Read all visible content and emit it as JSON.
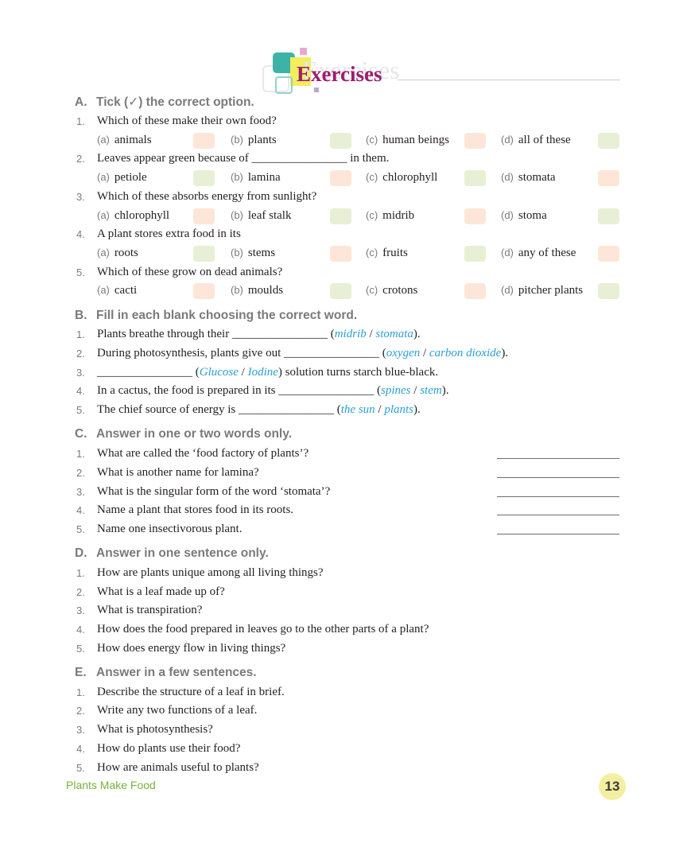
{
  "header": {
    "title": "Exercises"
  },
  "sections": {
    "A": {
      "letter": "A.",
      "heading": "Tick (✓) the correct option."
    },
    "B": {
      "letter": "B.",
      "heading": "Fill in each blank choosing the correct word."
    },
    "C": {
      "letter": "C.",
      "heading": "Answer in one or two words only."
    },
    "D": {
      "letter": "D.",
      "heading": "Answer in one sentence only."
    },
    "E": {
      "letter": "E.",
      "heading": "Answer in a few sentences."
    }
  },
  "mcq": [
    {
      "num": "1.",
      "q": "Which of these make their own food?",
      "opts": [
        {
          "l": "(a)",
          "t": "animals"
        },
        {
          "l": "(b)",
          "t": "plants"
        },
        {
          "l": "(c)",
          "t": "human beings"
        },
        {
          "l": "(d)",
          "t": "all of these"
        }
      ]
    },
    {
      "num": "2.",
      "q_pre": "Leaves appear green because of",
      "q_blank": "________________",
      "q_post": "in them.",
      "opts": [
        {
          "l": "(a)",
          "t": "petiole"
        },
        {
          "l": "(b)",
          "t": "lamina"
        },
        {
          "l": "(c)",
          "t": "chlorophyll"
        },
        {
          "l": "(d)",
          "t": "stomata"
        }
      ]
    },
    {
      "num": "3.",
      "q": "Which of these absorbs energy from sunlight?",
      "opts": [
        {
          "l": "(a)",
          "t": "chlorophyll"
        },
        {
          "l": "(b)",
          "t": "leaf stalk"
        },
        {
          "l": "(c)",
          "t": "midrib"
        },
        {
          "l": "(d)",
          "t": "stoma"
        }
      ]
    },
    {
      "num": "4.",
      "q": "A plant stores extra food in its",
      "opts": [
        {
          "l": "(a)",
          "t": "roots"
        },
        {
          "l": "(b)",
          "t": "stems"
        },
        {
          "l": "(c)",
          "t": "fruits"
        },
        {
          "l": "(d)",
          "t": "any of these"
        }
      ]
    },
    {
      "num": "5.",
      "q": "Which of these grow on dead animals?",
      "opts": [
        {
          "l": "(a)",
          "t": "cacti"
        },
        {
          "l": "(b)",
          "t": "moulds"
        },
        {
          "l": "(c)",
          "t": "crotons"
        },
        {
          "l": "(d)",
          "t": "pitcher plants"
        }
      ]
    }
  ],
  "fill": [
    {
      "num": "1.",
      "pre": "Plants breathe through their",
      "blank": "________________",
      "w1": "midrib",
      "sep": "/",
      "w2": "stomata",
      "post": ""
    },
    {
      "num": "2.",
      "pre": "During photosynthesis, plants give out",
      "blank": "________________",
      "w1": "oxygen",
      "sep": "/",
      "w2": "carbon dioxide",
      "post": ""
    },
    {
      "num": "3.",
      "pre": "",
      "blank": "________________",
      "w1": "Glucose",
      "sep": "/",
      "w2": "Iodine",
      "post": "solution turns starch blue-black."
    },
    {
      "num": "4.",
      "pre": "In a cactus, the food is prepared in its",
      "blank": "________________",
      "w1": "spines",
      "sep": "/",
      "w2": "stem",
      "post": ""
    },
    {
      "num": "5.",
      "pre": "The chief source of energy is",
      "blank": "________________",
      "w1": "the sun",
      "sep": "/",
      "w2": "plants",
      "post": ""
    }
  ],
  "short": [
    {
      "num": "1.",
      "q": "What are called the ‘food factory of plants’?"
    },
    {
      "num": "2.",
      "q": "What is another name for lamina?"
    },
    {
      "num": "3.",
      "q": "What is the singular form of the word ‘stomata’?"
    },
    {
      "num": "4.",
      "q": "Name a plant that stores food in its roots."
    },
    {
      "num": "5.",
      "q": "Name one insectivorous plant."
    }
  ],
  "sentence": [
    {
      "num": "1.",
      "q": "How are plants unique among all living things?"
    },
    {
      "num": "2.",
      "q": "What is a leaf made up of?"
    },
    {
      "num": "3.",
      "q": "What is transpiration?"
    },
    {
      "num": "4.",
      "q": "How does the food prepared in leaves go to the other parts of a plant?"
    },
    {
      "num": "5.",
      "q": "How does energy flow in living things?"
    }
  ],
  "few": [
    {
      "num": "1.",
      "q": "Describe the structure of a leaf in brief."
    },
    {
      "num": "2.",
      "q": "Write any two functions of a leaf."
    },
    {
      "num": "3.",
      "q": "What is photosynthesis?"
    },
    {
      "num": "4.",
      "q": "How do plants use their food?"
    },
    {
      "num": "5.",
      "q": "How are animals useful to plants?"
    }
  ],
  "footer": {
    "chapter": "Plants Make Food",
    "page": "13"
  },
  "colors": {
    "title": "#9c1e6e",
    "accent_blue": "#2a9fd6",
    "box_pink": "#fde6d8",
    "box_green": "#e7f0d5",
    "footer_green": "#77b33b",
    "page_circle": "#f4efa0"
  }
}
